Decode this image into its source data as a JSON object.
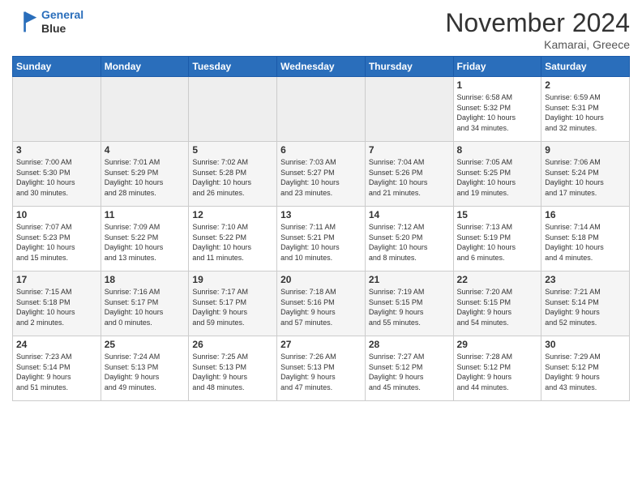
{
  "header": {
    "logo_line1": "General",
    "logo_line2": "Blue",
    "month": "November 2024",
    "location": "Kamarai, Greece"
  },
  "weekdays": [
    "Sunday",
    "Monday",
    "Tuesday",
    "Wednesday",
    "Thursday",
    "Friday",
    "Saturday"
  ],
  "weeks": [
    [
      {
        "day": "",
        "info": ""
      },
      {
        "day": "",
        "info": ""
      },
      {
        "day": "",
        "info": ""
      },
      {
        "day": "",
        "info": ""
      },
      {
        "day": "",
        "info": ""
      },
      {
        "day": "1",
        "info": "Sunrise: 6:58 AM\nSunset: 5:32 PM\nDaylight: 10 hours\nand 34 minutes."
      },
      {
        "day": "2",
        "info": "Sunrise: 6:59 AM\nSunset: 5:31 PM\nDaylight: 10 hours\nand 32 minutes."
      }
    ],
    [
      {
        "day": "3",
        "info": "Sunrise: 7:00 AM\nSunset: 5:30 PM\nDaylight: 10 hours\nand 30 minutes."
      },
      {
        "day": "4",
        "info": "Sunrise: 7:01 AM\nSunset: 5:29 PM\nDaylight: 10 hours\nand 28 minutes."
      },
      {
        "day": "5",
        "info": "Sunrise: 7:02 AM\nSunset: 5:28 PM\nDaylight: 10 hours\nand 26 minutes."
      },
      {
        "day": "6",
        "info": "Sunrise: 7:03 AM\nSunset: 5:27 PM\nDaylight: 10 hours\nand 23 minutes."
      },
      {
        "day": "7",
        "info": "Sunrise: 7:04 AM\nSunset: 5:26 PM\nDaylight: 10 hours\nand 21 minutes."
      },
      {
        "day": "8",
        "info": "Sunrise: 7:05 AM\nSunset: 5:25 PM\nDaylight: 10 hours\nand 19 minutes."
      },
      {
        "day": "9",
        "info": "Sunrise: 7:06 AM\nSunset: 5:24 PM\nDaylight: 10 hours\nand 17 minutes."
      }
    ],
    [
      {
        "day": "10",
        "info": "Sunrise: 7:07 AM\nSunset: 5:23 PM\nDaylight: 10 hours\nand 15 minutes."
      },
      {
        "day": "11",
        "info": "Sunrise: 7:09 AM\nSunset: 5:22 PM\nDaylight: 10 hours\nand 13 minutes."
      },
      {
        "day": "12",
        "info": "Sunrise: 7:10 AM\nSunset: 5:22 PM\nDaylight: 10 hours\nand 11 minutes."
      },
      {
        "day": "13",
        "info": "Sunrise: 7:11 AM\nSunset: 5:21 PM\nDaylight: 10 hours\nand 10 minutes."
      },
      {
        "day": "14",
        "info": "Sunrise: 7:12 AM\nSunset: 5:20 PM\nDaylight: 10 hours\nand 8 minutes."
      },
      {
        "day": "15",
        "info": "Sunrise: 7:13 AM\nSunset: 5:19 PM\nDaylight: 10 hours\nand 6 minutes."
      },
      {
        "day": "16",
        "info": "Sunrise: 7:14 AM\nSunset: 5:18 PM\nDaylight: 10 hours\nand 4 minutes."
      }
    ],
    [
      {
        "day": "17",
        "info": "Sunrise: 7:15 AM\nSunset: 5:18 PM\nDaylight: 10 hours\nand 2 minutes."
      },
      {
        "day": "18",
        "info": "Sunrise: 7:16 AM\nSunset: 5:17 PM\nDaylight: 10 hours\nand 0 minutes."
      },
      {
        "day": "19",
        "info": "Sunrise: 7:17 AM\nSunset: 5:17 PM\nDaylight: 9 hours\nand 59 minutes."
      },
      {
        "day": "20",
        "info": "Sunrise: 7:18 AM\nSunset: 5:16 PM\nDaylight: 9 hours\nand 57 minutes."
      },
      {
        "day": "21",
        "info": "Sunrise: 7:19 AM\nSunset: 5:15 PM\nDaylight: 9 hours\nand 55 minutes."
      },
      {
        "day": "22",
        "info": "Sunrise: 7:20 AM\nSunset: 5:15 PM\nDaylight: 9 hours\nand 54 minutes."
      },
      {
        "day": "23",
        "info": "Sunrise: 7:21 AM\nSunset: 5:14 PM\nDaylight: 9 hours\nand 52 minutes."
      }
    ],
    [
      {
        "day": "24",
        "info": "Sunrise: 7:23 AM\nSunset: 5:14 PM\nDaylight: 9 hours\nand 51 minutes."
      },
      {
        "day": "25",
        "info": "Sunrise: 7:24 AM\nSunset: 5:13 PM\nDaylight: 9 hours\nand 49 minutes."
      },
      {
        "day": "26",
        "info": "Sunrise: 7:25 AM\nSunset: 5:13 PM\nDaylight: 9 hours\nand 48 minutes."
      },
      {
        "day": "27",
        "info": "Sunrise: 7:26 AM\nSunset: 5:13 PM\nDaylight: 9 hours\nand 47 minutes."
      },
      {
        "day": "28",
        "info": "Sunrise: 7:27 AM\nSunset: 5:12 PM\nDaylight: 9 hours\nand 45 minutes."
      },
      {
        "day": "29",
        "info": "Sunrise: 7:28 AM\nSunset: 5:12 PM\nDaylight: 9 hours\nand 44 minutes."
      },
      {
        "day": "30",
        "info": "Sunrise: 7:29 AM\nSunset: 5:12 PM\nDaylight: 9 hours\nand 43 minutes."
      }
    ]
  ]
}
